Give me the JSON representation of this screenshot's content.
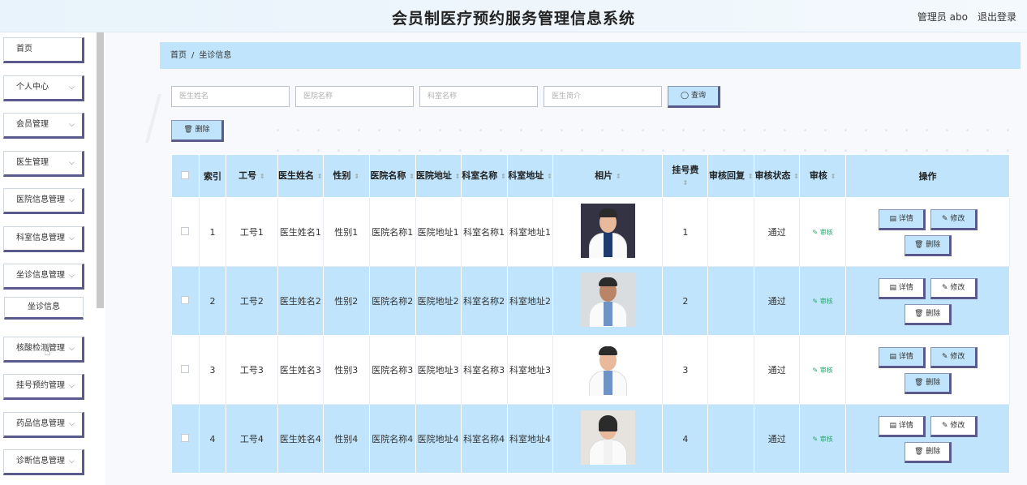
{
  "header": {
    "title": "会员制医疗预约服务管理信息系统",
    "user": "管理员 abo",
    "logout": "退出登录"
  },
  "sidebar": {
    "items": [
      {
        "label": "首页",
        "chev": ""
      },
      {
        "label": "个人中心",
        "chev": "⌵"
      },
      {
        "label": "会员管理",
        "chev": "⌵"
      },
      {
        "label": "医生管理",
        "chev": "⌵"
      },
      {
        "label": "医院信息管理",
        "chev": "⌵"
      },
      {
        "label": "科室信息管理",
        "chev": "⌵"
      },
      {
        "label": "坐诊信息管理",
        "chev": "⌵"
      },
      {
        "label": "核酸检测管理",
        "chev": "⌵"
      },
      {
        "label": "挂号预约管理",
        "chev": "⌵"
      },
      {
        "label": "药品信息管理",
        "chev": "⌵"
      },
      {
        "label": "诊断信息管理",
        "chev": "⌵"
      }
    ],
    "sub": "坐诊信息"
  },
  "breadcrumb": {
    "home": "首页",
    "sep": "/",
    "current": "坐诊信息"
  },
  "search": {
    "doctor": "医生姓名",
    "hospital": "医院名称",
    "dept": "科室名称",
    "intro": "医生简介",
    "query": "◯ 查询"
  },
  "toolbar": {
    "delete": "🗑 删除"
  },
  "table": {
    "columns": [
      "索引",
      "工号",
      "医生姓名",
      "性别",
      "医院名称",
      "医院地址",
      "科室名称",
      "科室地址",
      "相片",
      "挂号费",
      "审核回复",
      "审核状态",
      "审核",
      "操作"
    ],
    "rows": [
      {
        "index": "1",
        "no": "工号1",
        "name": "医生姓名1",
        "sex": "性别1",
        "hname": "医院名称1",
        "haddr": "医院地址1",
        "dname": "科室名称1",
        "daddr": "科室地址1",
        "fee": "1",
        "reply": "",
        "status": "通过",
        "audit": "✎ 审核"
      },
      {
        "index": "2",
        "no": "工号2",
        "name": "医生姓名2",
        "sex": "性别2",
        "hname": "医院名称2",
        "haddr": "医院地址2",
        "dname": "科室名称2",
        "daddr": "科室地址2",
        "fee": "2",
        "reply": "",
        "status": "通过",
        "audit": "✎ 审核"
      },
      {
        "index": "3",
        "no": "工号3",
        "name": "医生姓名3",
        "sex": "性别3",
        "hname": "医院名称3",
        "haddr": "医院地址3",
        "dname": "科室名称3",
        "daddr": "科室地址3",
        "fee": "3",
        "reply": "",
        "status": "通过",
        "audit": "✎ 审核"
      },
      {
        "index": "4",
        "no": "工号4",
        "name": "医生姓名4",
        "sex": "性别4",
        "hname": "医院名称4",
        "haddr": "医院地址4",
        "dname": "科室名称4",
        "daddr": "科室地址4",
        "fee": "4",
        "reply": "",
        "status": "通过",
        "audit": "✎ 审核"
      }
    ],
    "ops": {
      "detail": "▤ 详情",
      "edit": "✎ 修改",
      "delete": "🗑 删除"
    }
  },
  "colors": {
    "accent": "#bfe4fb",
    "border_dark": "#5a5a8c",
    "audit_green": "#25a56a"
  }
}
